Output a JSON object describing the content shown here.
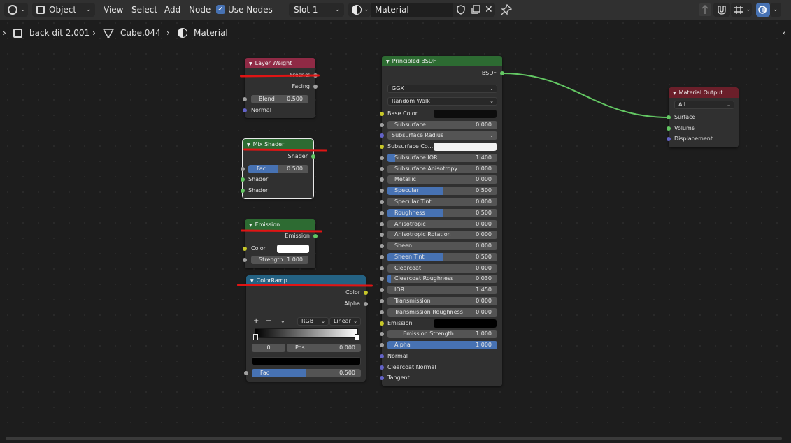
{
  "header": {
    "mode": "Object",
    "menus": [
      "View",
      "Select",
      "Add",
      "Node"
    ],
    "use_nodes_label": "Use Nodes",
    "slot": "Slot 1",
    "material_name": "Material"
  },
  "breadcrumb": {
    "scene": "back dit 2.001",
    "object": "Cube.044",
    "material": "Material"
  },
  "nodes": {
    "layer_weight": {
      "title": "Layer Weight",
      "out_fresnel": "Fresnel",
      "out_facing": "Facing",
      "blend_label": "Blend",
      "blend_value": "0.500",
      "normal": "Normal"
    },
    "mix_shader": {
      "title": "Mix Shader",
      "out_shader": "Shader",
      "fac_label": "Fac",
      "fac_value": "0.500",
      "in_shader1": "Shader",
      "in_shader2": "Shader"
    },
    "emission": {
      "title": "Emission",
      "out_emission": "Emission",
      "color_label": "Color",
      "strength_label": "Strength",
      "strength_value": "1.000"
    },
    "color_ramp": {
      "title": "ColorRamp",
      "out_color": "Color",
      "out_alpha": "Alpha",
      "plus": "+",
      "minus": "−",
      "mode": "RGB",
      "interp": "Linear",
      "index": "0",
      "pos_label": "Pos",
      "pos_value": "0.000",
      "fac_label": "Fac",
      "fac_value": "0.500"
    },
    "principled": {
      "title": "Principled BSDF",
      "out_bsdf": "BSDF",
      "distribution": "GGX",
      "subsurface_method": "Random Walk",
      "base_color_label": "Base Color",
      "subsurface_radius_label": "Subsurface Radius",
      "subsurface_color_label": "Subsurface Co...",
      "emission_label": "Emission",
      "normal": "Normal",
      "clearcoat_normal": "Clearcoat Normal",
      "tangent": "Tangent",
      "fields": [
        {
          "label": "Subsurface",
          "value": "0.000",
          "fill": 0
        },
        {
          "label": "Subsurface IOR",
          "value": "1.400",
          "fill": 0.07
        },
        {
          "label": "Subsurface Anisotropy",
          "value": "0.000",
          "fill": 0
        },
        {
          "label": "Metallic",
          "value": "0.000",
          "fill": 0
        },
        {
          "label": "Specular",
          "value": "0.500",
          "fill": 0.5
        },
        {
          "label": "Specular Tint",
          "value": "0.000",
          "fill": 0
        },
        {
          "label": "Roughness",
          "value": "0.500",
          "fill": 0.5
        },
        {
          "label": "Anisotropic",
          "value": "0.000",
          "fill": 0
        },
        {
          "label": "Anisotropic Rotation",
          "value": "0.000",
          "fill": 0
        },
        {
          "label": "Sheen",
          "value": "0.000",
          "fill": 0
        },
        {
          "label": "Sheen Tint",
          "value": "0.500",
          "fill": 0.5
        },
        {
          "label": "Clearcoat",
          "value": "0.000",
          "fill": 0
        },
        {
          "label": "Clearcoat Roughness",
          "value": "0.030",
          "fill": 0.03
        },
        {
          "label": "IOR",
          "value": "1.450",
          "fill": 0
        },
        {
          "label": "Transmission",
          "value": "0.000",
          "fill": 0
        },
        {
          "label": "Transmission Roughness",
          "value": "0.000",
          "fill": 0
        }
      ],
      "emission_strength_label": "Emission Strength",
      "emission_strength_value": "1.000",
      "alpha_label": "Alpha",
      "alpha_value": "1.000"
    },
    "output": {
      "title": "Material Output",
      "target": "All",
      "surface": "Surface",
      "volume": "Volume",
      "displacement": "Displacement"
    }
  },
  "colors": {
    "accent_blue": "#4772b3",
    "shader_header": "#2d6b32",
    "input_header": "#8f2a45",
    "converter_header": "#246283",
    "output_header": "#6b1f2a",
    "red_marker": "#e01414",
    "link_green": "#63c763"
  }
}
